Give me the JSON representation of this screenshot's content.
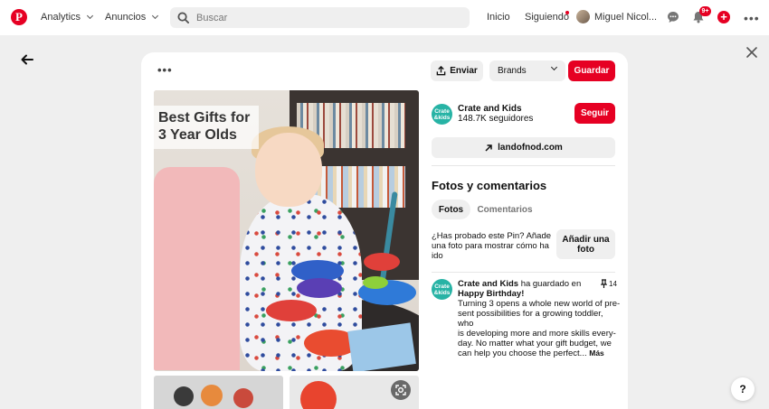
{
  "nav": {
    "logo": "P",
    "analytics": "Analytics",
    "ads": "Anuncios",
    "search_placeholder": "Buscar",
    "home": "Inicio",
    "following": "Siguiendo",
    "user_name": "Miguel Nicol...",
    "notif_badge": "9+"
  },
  "pin": {
    "image_title_line1": "Best Gifts for",
    "image_title_line2": "3 Year Olds",
    "send_label": "Enviar",
    "board_select": "Brands",
    "save_label": "Guardar"
  },
  "creator": {
    "logo_text_line1": "Crate",
    "logo_text_line2": "&kids",
    "name": "Crate and Kids",
    "followers": "148.7K seguidores",
    "follow_label": "Seguir",
    "link": "landofnod.com"
  },
  "photos_comments": {
    "title": "Fotos y comentarios",
    "tab_photos": "Fotos",
    "tab_comments": "Comentarios",
    "prompt_line1": "¿Has probado este Pin? Añade",
    "prompt_line2": "una foto para mostrar cómo ha",
    "prompt_line3": "ido",
    "add_photo_line1": "Añadir una",
    "add_photo_line2": "foto"
  },
  "activity": {
    "name": "Crate and Kids",
    "action": "ha guardado en",
    "board": "Happy Birthday!",
    "save_count": "14",
    "desc_line1": "Turning 3 opens a whole new world of pre-",
    "desc_line2": "sent possibilities for a growing toddler, who",
    "desc_line3": "is developing more and more skills every-",
    "desc_line4": "day. No matter what your gift budget, we",
    "desc_line5": "can help you choose the perfect...",
    "more": "Más"
  },
  "help": "?",
  "colors": {
    "brand_red": "#e60023",
    "creator_teal": "#27b3a5",
    "button_gray": "#efefef"
  },
  "icons": [
    "pinterest-logo-icon",
    "search-icon",
    "chat-icon",
    "bell-icon",
    "plus-icon",
    "more-icon",
    "back-arrow-icon",
    "close-icon",
    "share-icon",
    "external-link-icon",
    "pin-icon",
    "visual-search-icon"
  ]
}
